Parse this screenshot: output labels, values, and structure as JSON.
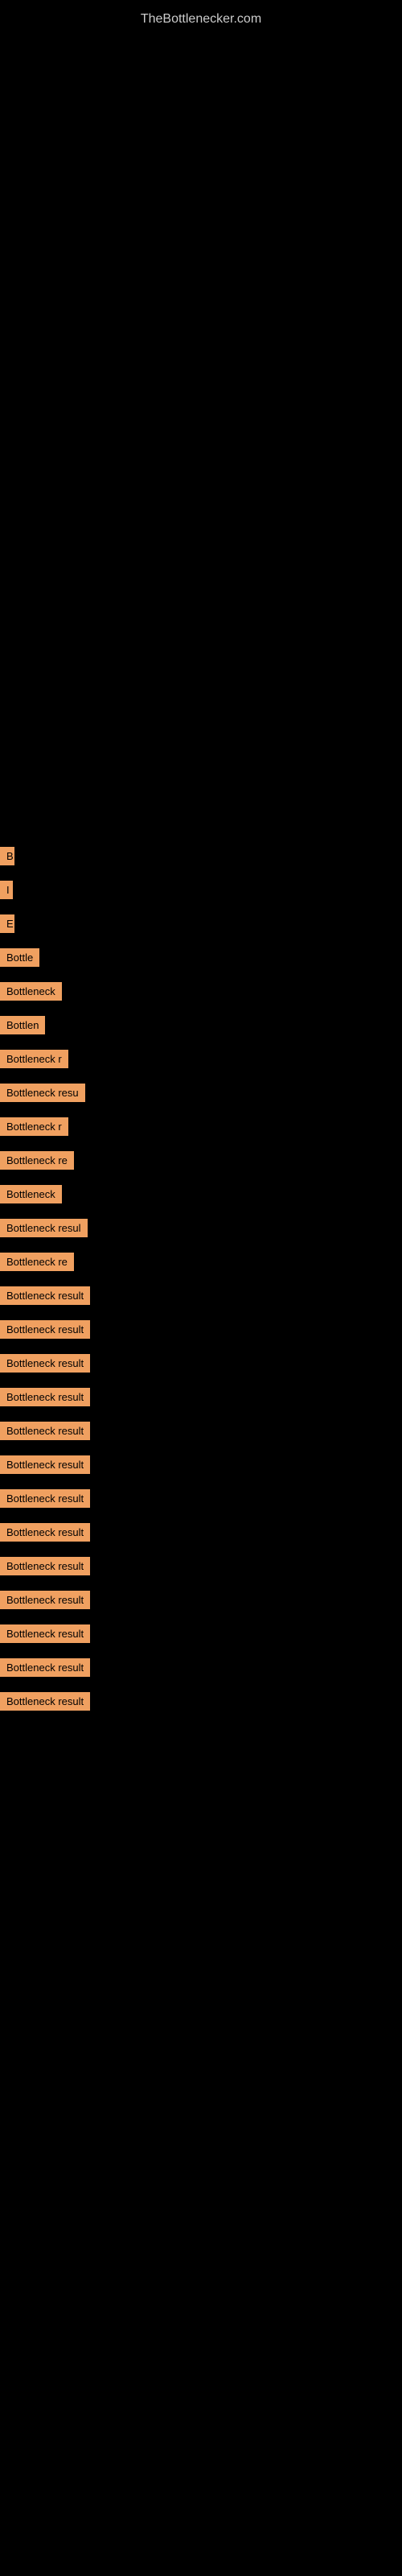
{
  "site": {
    "title": "TheBottlenecker.com"
  },
  "items": [
    {
      "id": 1,
      "label": "B",
      "width": 18
    },
    {
      "id": 2,
      "label": "I",
      "width": 15
    },
    {
      "id": 3,
      "label": "E",
      "width": 18
    },
    {
      "id": 4,
      "label": "Bottle",
      "width": 52
    },
    {
      "id": 5,
      "label": "Bottleneck",
      "width": 90
    },
    {
      "id": 6,
      "label": "Bottlen",
      "width": 75
    },
    {
      "id": 7,
      "label": "Bottleneck r",
      "width": 105
    },
    {
      "id": 8,
      "label": "Bottleneck resu",
      "width": 130
    },
    {
      "id": 9,
      "label": "Bottleneck r",
      "width": 105
    },
    {
      "id": 10,
      "label": "Bottleneck re",
      "width": 115
    },
    {
      "id": 11,
      "label": "Bottleneck",
      "width": 90
    },
    {
      "id": 12,
      "label": "Bottleneck resul",
      "width": 140
    },
    {
      "id": 13,
      "label": "Bottleneck re",
      "width": 115
    },
    {
      "id": 14,
      "label": "Bottleneck result",
      "width": 150
    },
    {
      "id": 15,
      "label": "Bottleneck result",
      "width": 150
    },
    {
      "id": 16,
      "label": "Bottleneck result",
      "width": 150
    },
    {
      "id": 17,
      "label": "Bottleneck result",
      "width": 150
    },
    {
      "id": 18,
      "label": "Bottleneck result",
      "width": 150
    },
    {
      "id": 19,
      "label": "Bottleneck result",
      "width": 150
    },
    {
      "id": 20,
      "label": "Bottleneck result",
      "width": 150
    },
    {
      "id": 21,
      "label": "Bottleneck result",
      "width": 150
    },
    {
      "id": 22,
      "label": "Bottleneck result",
      "width": 150
    },
    {
      "id": 23,
      "label": "Bottleneck result",
      "width": 150
    },
    {
      "id": 24,
      "label": "Bottleneck result",
      "width": 150
    },
    {
      "id": 25,
      "label": "Bottleneck result",
      "width": 150
    },
    {
      "id": 26,
      "label": "Bottleneck result",
      "width": 150
    }
  ]
}
